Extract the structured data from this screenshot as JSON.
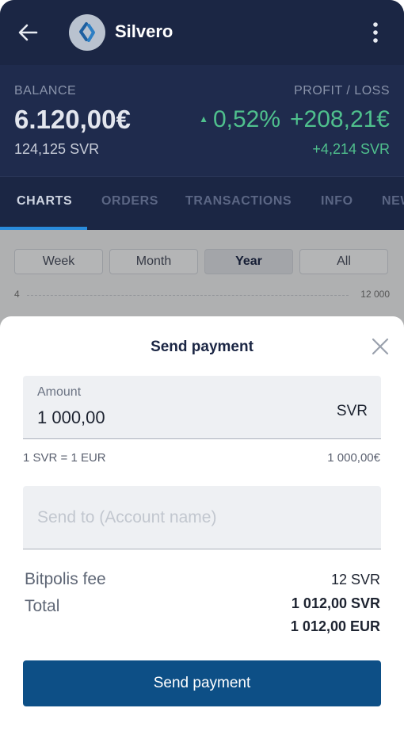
{
  "header": {
    "title": "Silvero"
  },
  "balance": {
    "label": "BALANCE",
    "value": "6.120,00€",
    "sub": "124,125 SVR",
    "pl_label": "PROFIT / LOSS",
    "pl_percent": "0,52%",
    "pl_value": "+208,21€",
    "pl_sub": "+4,214 SVR",
    "positive_color": "#4fc08d"
  },
  "tabs": [
    "CHARTS",
    "ORDERS",
    "TRANSACTIONS",
    "INFO",
    "NEWS"
  ],
  "chart": {
    "periods": [
      "Week",
      "Month",
      "Year",
      "All"
    ],
    "active_period": "Year",
    "axis_left": "4",
    "axis_right": "12 000"
  },
  "modal": {
    "title": "Send payment",
    "amount_label": "Amount",
    "amount_value": "1 000,00",
    "amount_unit": "SVR",
    "rate_left": "1 SVR = 1 EUR",
    "rate_right": "1 000,00€",
    "sendto_placeholder": "Send to (Account name)",
    "fee_label": "Bitpolis fee",
    "fee_value": "12 SVR",
    "total_label": "Total",
    "total_svr": "1 012,00 SVR",
    "total_eur": "1 012,00 EUR",
    "button_label": "Send payment",
    "button_color": "#0d4f86"
  }
}
